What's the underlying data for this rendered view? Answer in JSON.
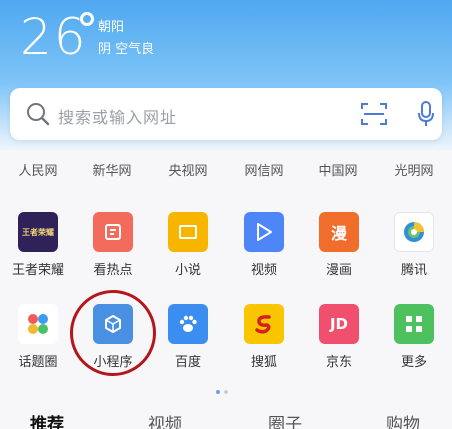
{
  "colors": {
    "accent": "#4fa8f0",
    "highlight_ring": "#b4161b"
  },
  "weather": {
    "temperature": "26",
    "city": "朝阳",
    "condition": "阴 空气良"
  },
  "search": {
    "placeholder": "搜索或输入网址"
  },
  "sites": [
    "人民网",
    "新华网",
    "央视网",
    "网信网",
    "中国网",
    "光明网"
  ],
  "apps_row1": [
    {
      "label": "王者荣耀",
      "icon": "game-icon",
      "color": "#3a2a6a"
    },
    {
      "label": "看热点",
      "icon": "hot-news-icon",
      "color": "#f26b5b"
    },
    {
      "label": "小说",
      "icon": "book-icon",
      "color": "#f7b500"
    },
    {
      "label": "视频",
      "icon": "play-icon",
      "color": "#4f86f7"
    },
    {
      "label": "漫画",
      "icon": "comic-icon",
      "color": "#f06d2c"
    },
    {
      "label": "腾讯",
      "icon": "tencent-icon",
      "color": "#ffffff"
    }
  ],
  "apps_row2": [
    {
      "label": "话题圈",
      "icon": "topic-icon",
      "color": "#ffffff"
    },
    {
      "label": "小程序",
      "icon": "mini-program-icon",
      "color": "#4a90e2"
    },
    {
      "label": "百度",
      "icon": "paw-icon",
      "color": "#3b8ef0"
    },
    {
      "label": "搜狐",
      "icon": "sohu-icon",
      "color": "#f7c600"
    },
    {
      "label": "京东",
      "icon": "jd-icon",
      "color": "#f0506e"
    },
    {
      "label": "更多",
      "icon": "more-grid-icon",
      "color": "#4cc15e"
    }
  ],
  "tile_text": {
    "game": "王者荣耀",
    "comic": "漫",
    "jd": "JD"
  },
  "tabs": [
    "推荐",
    "视频",
    "圈子",
    "购物"
  ]
}
